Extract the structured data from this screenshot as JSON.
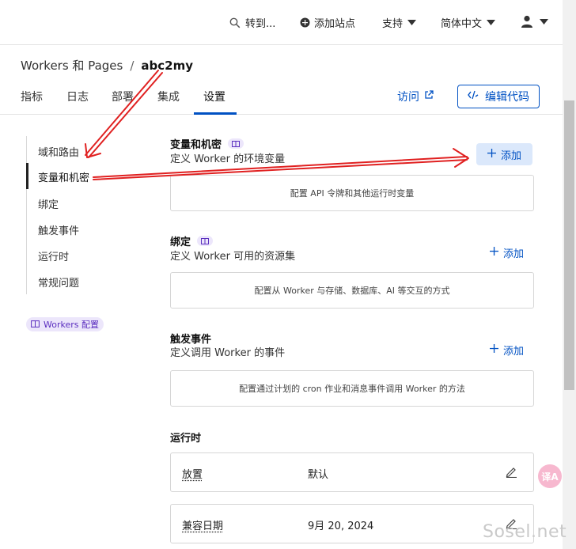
{
  "topbar": {
    "goto_label": "转到...",
    "add_site_label": "添加站点",
    "support_label": "支持",
    "language_label": "简体中文"
  },
  "breadcrumb": {
    "parent": "Workers 和 Pages",
    "separator": "/",
    "current": "abc2my"
  },
  "tabs": [
    {
      "label": "指标"
    },
    {
      "label": "日志"
    },
    {
      "label": "部署"
    },
    {
      "label": "集成"
    },
    {
      "label": "设置",
      "active": true
    }
  ],
  "actions": {
    "visit_label": "访问",
    "edit_code_label": "编辑代码"
  },
  "sidenav": {
    "items": [
      {
        "label": "域和路由"
      },
      {
        "label": "变量和机密",
        "active": true
      },
      {
        "label": "绑定"
      },
      {
        "label": "触发事件"
      },
      {
        "label": "运行时"
      },
      {
        "label": "常规问题"
      }
    ],
    "badge_label": "Workers 配置"
  },
  "sections": {
    "variables": {
      "title": "变量和机密",
      "desc": "定义 Worker 的环境变量",
      "add_label": "添加",
      "empty_text": "配置 API 令牌和其他运行时变量"
    },
    "bindings": {
      "title": "绑定",
      "desc": "定义 Worker 可用的资源集",
      "add_label": "添加",
      "empty_text": "配置从 Worker 与存储、数据库、AI 等交互的方式"
    },
    "triggers": {
      "title": "触发事件",
      "desc": "定义调用 Worker 的事件",
      "add_label": "添加",
      "empty_text": "配置通过计划的 cron 作业和消息事件调用 Worker 的方法"
    },
    "runtime": {
      "title": "运行时",
      "rows": [
        {
          "key": "放置",
          "value": "默认"
        },
        {
          "key": "兼容日期",
          "value": "9月 20, 2024"
        }
      ]
    }
  },
  "floating": {
    "translate_label": "译A"
  },
  "watermark": "Sosel.net",
  "colors": {
    "accent": "#0051c3",
    "annotation_arrow": "#e02020",
    "badge_bg": "#ece6fb"
  },
  "icons": [
    "search-icon",
    "plus-circle-icon",
    "chevron-down-icon",
    "user-icon",
    "external-link-icon",
    "code-icon",
    "book-icon",
    "plus-icon",
    "pencil-icon"
  ]
}
